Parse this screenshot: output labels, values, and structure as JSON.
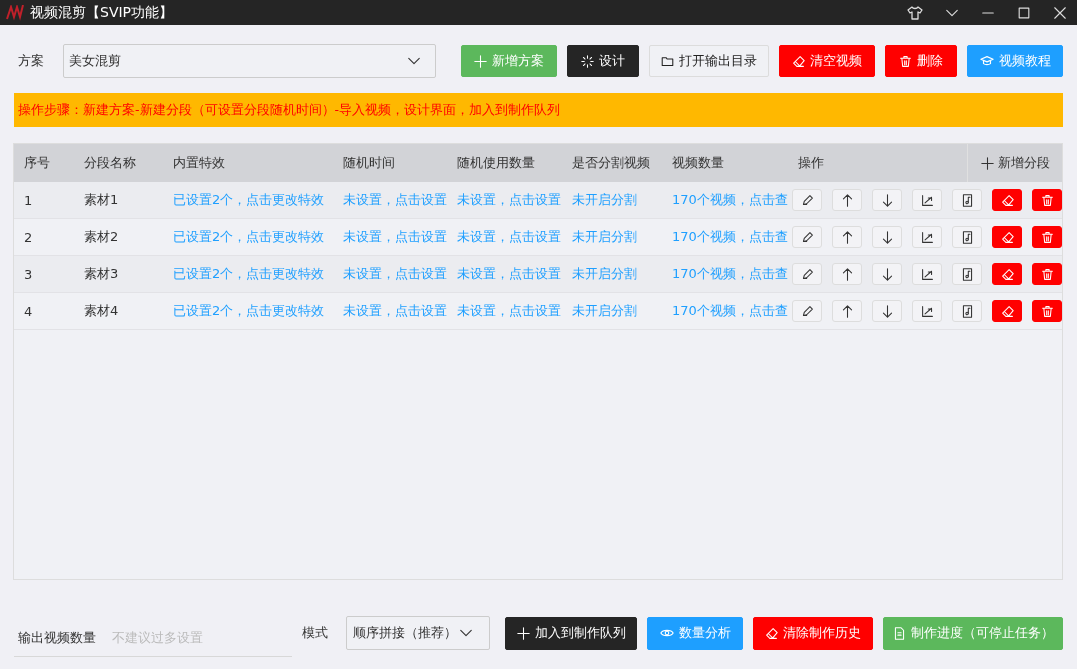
{
  "window": {
    "title": "视频混剪【SVIP功能】"
  },
  "scheme": {
    "label": "方案",
    "value": "美女混剪"
  },
  "toolbar": [
    {
      "label": "新增方案",
      "kind": "green"
    },
    {
      "label": "设计",
      "kind": "dark"
    },
    {
      "label": "打开输出目录",
      "kind": "light"
    },
    {
      "label": "清空视频",
      "kind": "red"
    },
    {
      "label": "删除",
      "kind": "red"
    },
    {
      "label": "视频教程",
      "kind": "blue"
    }
  ],
  "notice": "操作步骤：新建方案-新建分段（可设置分段随机时间）-导入视频，设计界面，加入到制作队列",
  "table": {
    "columns": [
      "序号",
      "分段名称",
      "内置特效",
      "随机时间",
      "随机使用数量",
      "是否分割视频",
      "视频数量",
      "操作"
    ],
    "add_button": "新增分段",
    "rows": [
      {
        "cells": [
          "1",
          "素材1",
          "已设置2个，点击更改特效",
          "未设置，点击设置",
          "未设置，点击设置",
          "未开启分割",
          "170个视频，点击查"
        ]
      },
      {
        "cells": [
          "2",
          "素材2",
          "已设置2个，点击更改特效",
          "未设置，点击设置",
          "未设置，点击设置",
          "未开启分割",
          "170个视频，点击查"
        ]
      },
      {
        "cells": [
          "3",
          "素材3",
          "已设置2个，点击更改特效",
          "未设置，点击设置",
          "未设置，点击设置",
          "未开启分割",
          "170个视频，点击查"
        ]
      },
      {
        "cells": [
          "4",
          "素材4",
          "已设置2个，点击更改特效",
          "未设置，点击设置",
          "未设置，点击设置",
          "未开启分割",
          "170个视频，点击查"
        ]
      }
    ]
  },
  "output": {
    "label": "输出视频数量",
    "placeholder": "不建议过多设置"
  },
  "mode": {
    "label": "模式",
    "value": "顺序拼接（推荐）"
  },
  "actions": [
    {
      "label": "加入到制作队列",
      "kind": "dark"
    },
    {
      "label": "数量分析",
      "kind": "blue"
    },
    {
      "label": "清除制作历史",
      "kind": "red"
    },
    {
      "label": "制作进度（可停止任务）",
      "kind": "green"
    }
  ]
}
